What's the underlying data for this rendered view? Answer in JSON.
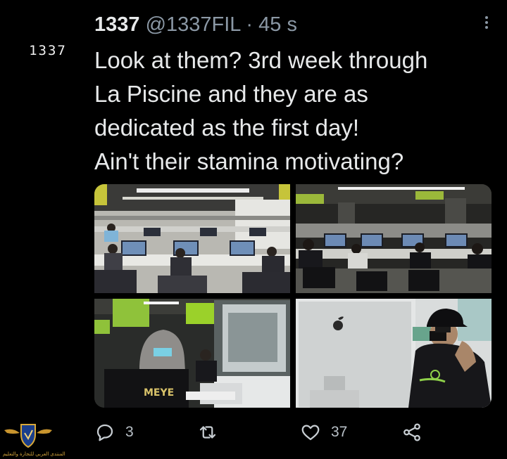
{
  "tweet": {
    "avatar_text": "1337",
    "display_name": "1337",
    "handle": "@1337FIL",
    "separator": "·",
    "time": "45 s",
    "text_lines": [
      "Look at them? 3rd week through",
      "La Piscine and they are as",
      "dedicated as the first day!",
      "Ain't their stamina motivating?"
    ]
  },
  "media": {
    "photos": [
      {
        "name": "classroom-rows-photo"
      },
      {
        "name": "students-at-computers-photo"
      },
      {
        "name": "masked-student-with-headscarf-photo"
      },
      {
        "name": "student-with-cap-at-imac-photo"
      }
    ],
    "shirt_text": "MEYE"
  },
  "actions": {
    "reply_count": "3",
    "retweet_count": "",
    "like_count": "37",
    "share_count": ""
  },
  "colors": {
    "background": "#000000",
    "text": "#e7e9ea",
    "secondary": "#8b98a5",
    "accent_green": "#9bd12a"
  },
  "watermark": {
    "text": "المنتدى العربي للتجارة والتعليم"
  }
}
